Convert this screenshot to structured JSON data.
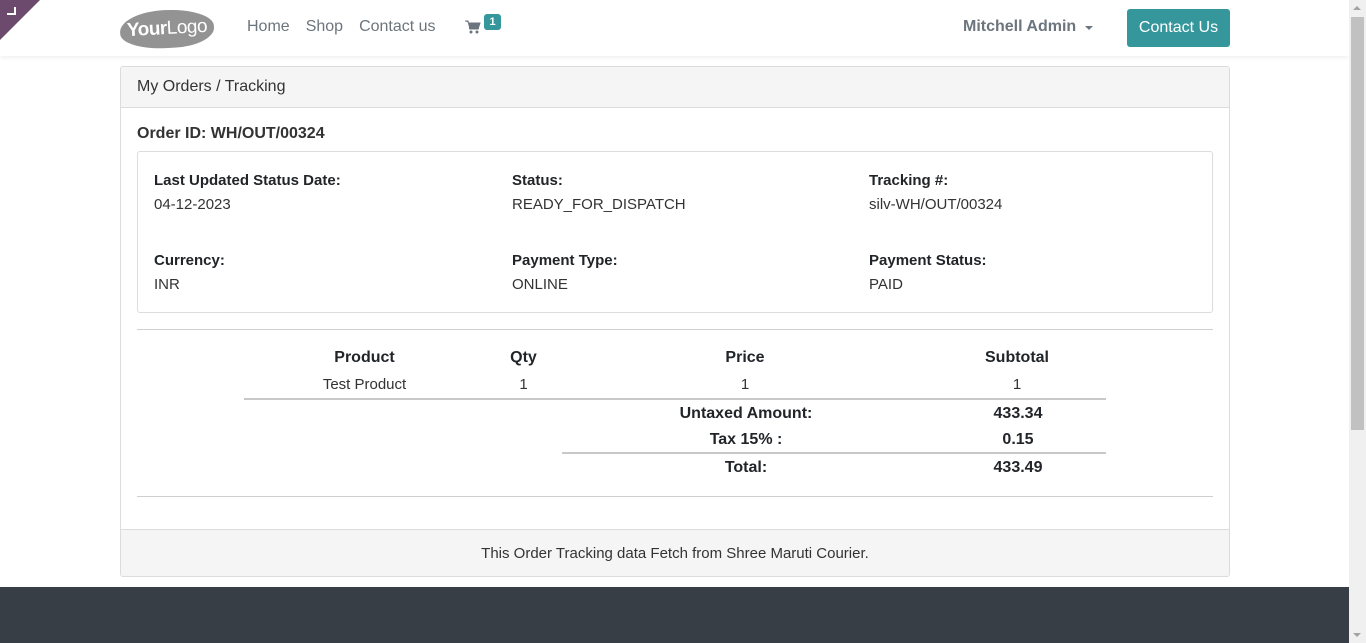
{
  "header": {
    "logo_bold": "Your",
    "logo_light": "Logo",
    "nav": [
      "Home",
      "Shop",
      "Contact us"
    ],
    "cart_icon": "shopping-cart-icon",
    "cart_count": "1",
    "user_name": "Mitchell Admin",
    "contact_button": "Contact Us"
  },
  "card": {
    "breadcrumb": "My Orders / Tracking",
    "order_id_label": "Order ID: WH/OUT/00324",
    "info": [
      {
        "label": "Last Updated Status Date:",
        "value": "04-12-2023"
      },
      {
        "label": "Status:",
        "value": "READY_FOR_DISPATCH"
      },
      {
        "label": "Tracking #:",
        "value": "silv-WH/OUT/00324"
      },
      {
        "label": "Currency:",
        "value": "INR"
      },
      {
        "label": "Payment Type:",
        "value": "ONLINE"
      },
      {
        "label": "Payment Status:",
        "value": "PAID"
      }
    ],
    "table": {
      "headers": [
        "Product",
        "Qty",
        "Price",
        "Subtotal"
      ],
      "rows": [
        [
          "Test Product",
          "1",
          "1",
          "1"
        ]
      ]
    },
    "totals": {
      "untaxed_label": "Untaxed Amount:",
      "untaxed_value": "433.34",
      "tax_label": "Tax 15% :",
      "tax_value": "0.15",
      "total_label": "Total:",
      "total_value": "433.49"
    },
    "footer_note": "This Order Tracking data Fetch from Shree Maruti Courier."
  },
  "colors": {
    "accent": "#35979c",
    "corner": "#6b4a6e",
    "footer_bg": "#383e45"
  }
}
